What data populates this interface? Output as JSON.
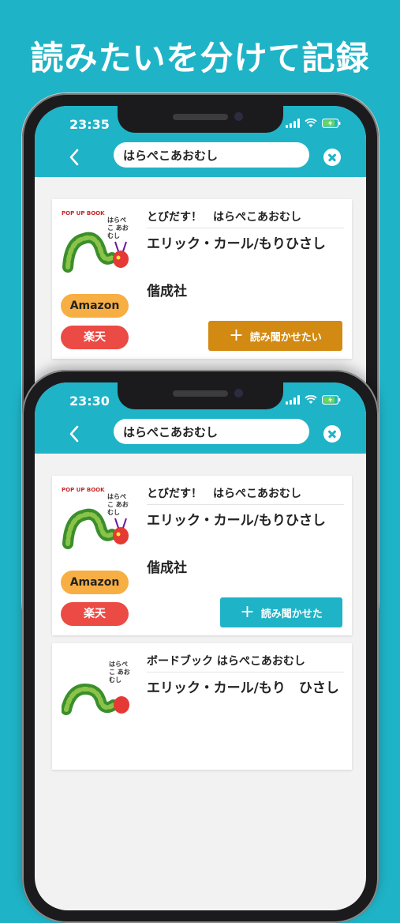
{
  "headline": "読みたいを分けて記録",
  "colors": {
    "brand": "#1fb3c7",
    "amazon": "#f7ae42",
    "rakuten": "#ec4a44",
    "want_to_read_button": "#d38a12",
    "read_button": "#1fb3c7"
  },
  "phone_back": {
    "status_time": "23:35",
    "search_value": "はらぺこあおむし",
    "book": {
      "title": "とびだす！　はらぺこあおむし",
      "author": "エリック・カール/もりひさし",
      "publisher": "偕成社",
      "cover_label_top": "POP UP BOOK",
      "cover_label_side": "はらぺこ あおむし",
      "amazon_label": "Amazon",
      "rakuten_label": "楽天",
      "action_label": "読み聞かせたい",
      "action_icon": "plus-icon"
    }
  },
  "phone_front": {
    "status_time": "23:30",
    "search_value": "はらぺこあおむし",
    "book": {
      "title": "とびだす！　はらぺこあおむし",
      "author": "エリック・カール/もりひさし",
      "publisher": "偕成社",
      "cover_label_top": "POP UP BOOK",
      "cover_label_side": "はらぺこ あおむし",
      "amazon_label": "Amazon",
      "rakuten_label": "楽天",
      "action_label": "読み聞かせた",
      "action_icon": "plus-icon"
    },
    "book2": {
      "title": "ボードブック はらぺこあおむし",
      "author": "エリック・カール/もり　ひさし",
      "cover_label_side": "はらぺこ あおむし"
    }
  }
}
